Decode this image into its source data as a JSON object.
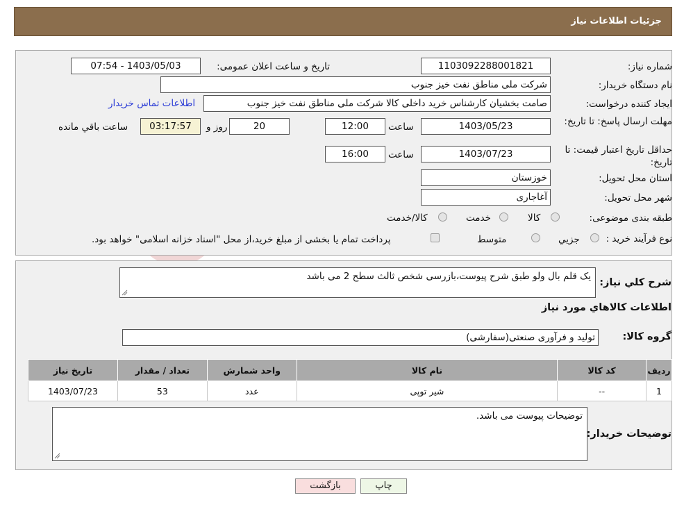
{
  "header": {
    "title": "جزئیات اطلاعات نیاز"
  },
  "watermark": {
    "text": "AriaTender.neT"
  },
  "form": {
    "need_number_label": "شماره نیاز:",
    "need_number": "1103092288001821",
    "announce_label": "تاریخ و ساعت اعلان عمومی:",
    "announce_value": "1403/05/03 - 07:54",
    "buyer_label": "نام دستگاه خریدار:",
    "buyer_value": "شرکت ملی مناطق نفت خیز جنوب",
    "creator_label": "ایجاد کننده درخواست:",
    "creator_value": "صامت  بخشیان  کارشناس خرید داخلی کالا  شرکت ملی مناطق نفت خیز جنوب",
    "contact_link": "اطلاعات تماس خریدار",
    "reply_deadline_label": "مهلت ارسال پاسخ: تا تاریخ:",
    "reply_date": "1403/05/23",
    "time_label": "ساعت",
    "reply_time": "12:00",
    "days_value": "20",
    "days_label": "روز و",
    "remaining_value": "03:17:57",
    "remaining_label": "ساعت باقي مانده",
    "validity_label": "حداقل تاریخ اعتبار قیمت: تا تاریخ:",
    "validity_date": "1403/07/23",
    "validity_time": "16:00",
    "province_label": "استان محل تحویل:",
    "province_value": "خوزستان",
    "city_label": "شهر محل تحویل:",
    "city_value": "آغاجاری",
    "category_label": "طبقه بندی موضوعی:",
    "category_options": [
      "کالا",
      "خدمت",
      "کالا/خدمت"
    ],
    "process_label": "نوع فرآیند خرید :",
    "process_options": [
      "جزيي",
      "متوسط"
    ],
    "process_note": "پرداخت تمام یا بخشی از مبلغ خرید،از محل \"اسناد خزانه اسلامی\" خواهد بود."
  },
  "details": {
    "summary_label": "شرح کلي نياز:",
    "summary_value": "یک قلم بال ولو طبق شرح پیوست،بازرسی شخص ثالث سطح 2 می باشد",
    "goods_info_title": "اطلاعات کالاهاي مورد نياز",
    "group_label": "گروه کالا:",
    "group_value": "تولید و فرآوری صنعتی(سفارشی)",
    "table": {
      "headers": [
        "رديف",
        "کد کالا",
        "نام کالا",
        "واحد شمارش",
        "تعداد / مقدار",
        "تاریخ نیاز"
      ],
      "rows": [
        [
          "1",
          "--",
          "شیر توپی",
          "عدد",
          "53",
          "1403/07/23"
        ]
      ]
    },
    "buyer_notes_label": "توضیحات خریدار:",
    "buyer_notes_value": "توضیحات پیوست می باشد."
  },
  "buttons": {
    "print": "چاپ",
    "back": "بازگشت"
  }
}
